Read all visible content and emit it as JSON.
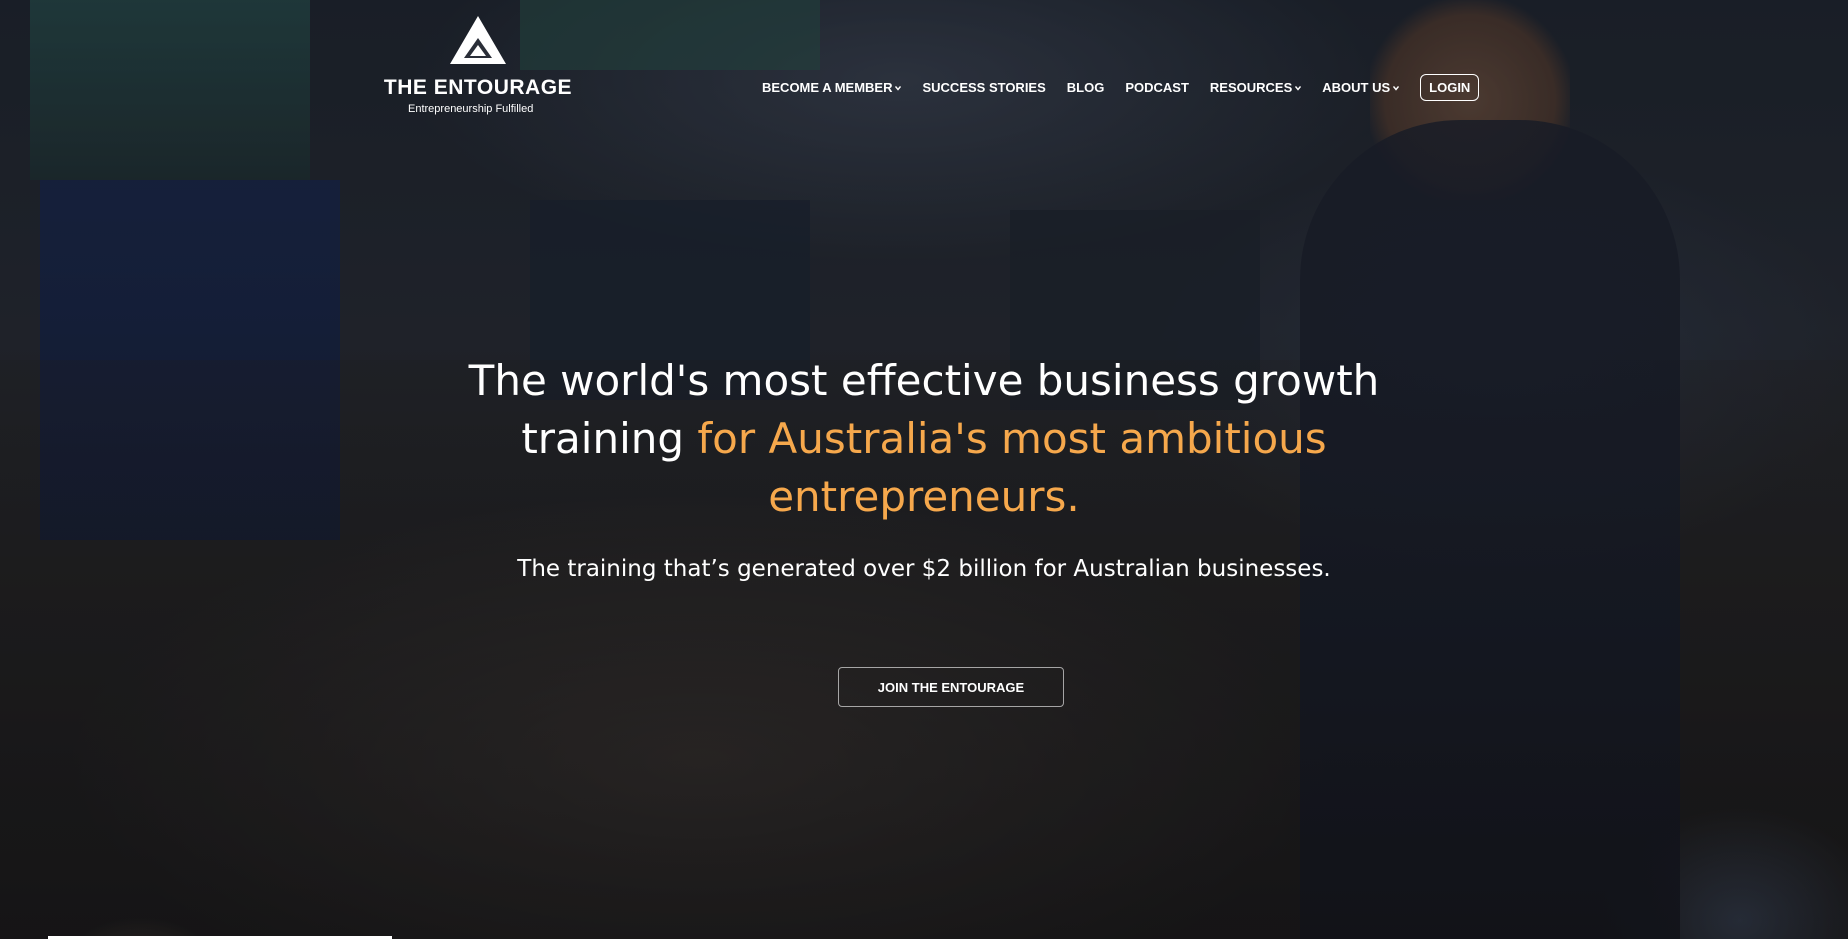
{
  "header": {
    "logo": {
      "name": "THE ENTOURAGE",
      "tagline": "Entrepreneurship Fulfilled",
      "icon": "triangle-logo-icon"
    },
    "nav": {
      "become_member": "BECOME A MEMBER",
      "success_stories": "SUCCESS STORIES",
      "blog": "BLOG",
      "podcast": "PODCAST",
      "resources": "RESOURCES",
      "about_us": "ABOUT US",
      "login": "LOGIN"
    }
  },
  "hero": {
    "headline_part1": "The world's most effective business growth training",
    "headline_accent": "for Australia's most ambitious entrepreneurs.",
    "subheadline": "The training that’s generated over $2 billion for Australian businesses.",
    "cta": "JOIN THE ENTOURAGE",
    "background": "conference-audience-photo"
  },
  "colors": {
    "accent": "#f6a84c",
    "text": "#ffffff"
  }
}
